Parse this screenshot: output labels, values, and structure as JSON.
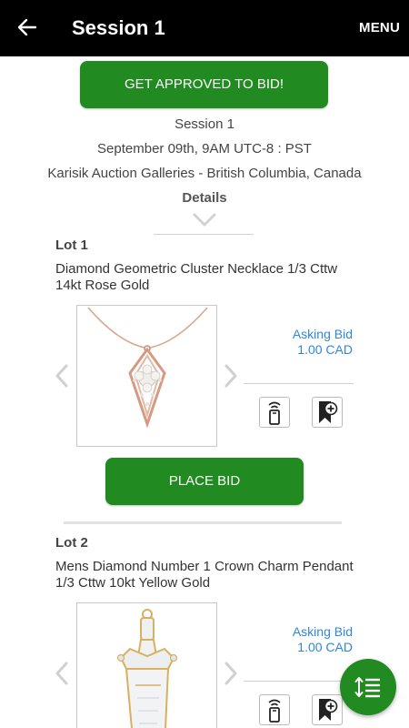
{
  "header": {
    "back_icon": "arrow-left-icon",
    "title": "Session 1",
    "menu_label": "MENU"
  },
  "session": {
    "approve_button": "GET APPROVED TO BID!",
    "name": "Session 1",
    "date": "September 09th, 9AM UTC-8 : PST",
    "location": "Karisik Auction Galleries - British Columbia, Canada",
    "details_label": "Details"
  },
  "lots": [
    {
      "label": "Lot 1",
      "name": "Diamond Geometric Cluster Necklace 1/3 Cttw 14kt Rose Gold",
      "asking_label": "Asking Bid",
      "asking_value": "1.00 CAD",
      "image": "rose-gold-diamond-necklace",
      "place_bid_label": "PLACE BID"
    },
    {
      "label": "Lot 2",
      "name": "Mens Diamond Number 1 Crown Charm Pendant 1/3 Cttw 10kt Yellow Gold",
      "asking_label": "Asking Bid",
      "asking_value": "1.00 CAD",
      "image": "number-one-crown-pendant"
    }
  ],
  "fab": {
    "icon": "sort-list-icon"
  },
  "colors": {
    "header_bg": "#000000",
    "primary_green": "#218b21",
    "bid_blue": "#2e86de"
  }
}
